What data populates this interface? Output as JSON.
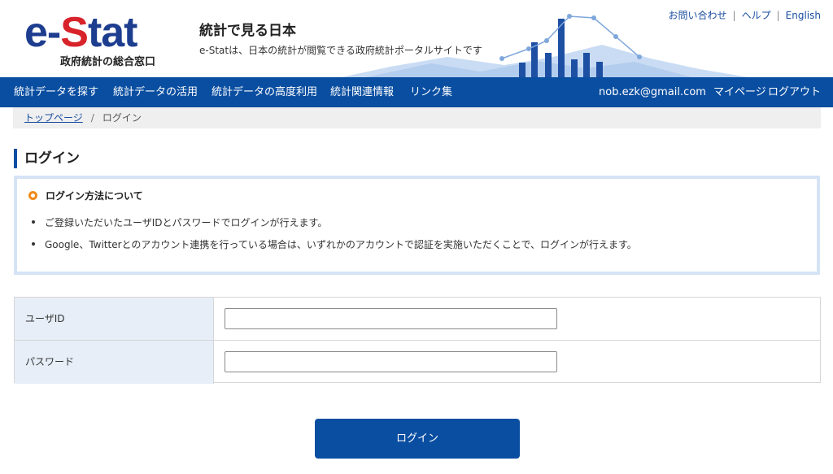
{
  "header": {
    "logo": {
      "e": "e",
      "dash": "-",
      "s": "S",
      "tat": "tat",
      "subtitle": "政府統計の総合窓口"
    },
    "site_title": "統計で見る日本",
    "site_desc": "e-Statは、日本の統計が閲覧できる政府統計ポータルサイトです",
    "utility_links": {
      "contact": "お問い合わせ",
      "help": "ヘルプ",
      "english": "English",
      "separator": "|"
    }
  },
  "nav": {
    "items": [
      "統計データを探す",
      "統計データの活用",
      "統計データの高度利用",
      "統計関連情報",
      "リンク集"
    ],
    "user_email": "nob.ezk@gmail.com",
    "mypage": "マイページ",
    "logout": "ログアウト"
  },
  "breadcrumb": {
    "home": "トップページ",
    "separator": "/",
    "current": "ログイン"
  },
  "page_title": "ログイン",
  "info": {
    "heading": "ログイン方法について",
    "items": [
      "ご登録いただいたユーザIDとパスワードでログインが行えます。",
      "Google、Twitterとのアカウント連携を行っている場合は、いずれかのアカウントで認証を実施いただくことで、ログインが行えます。"
    ]
  },
  "form": {
    "user_id_label": "ユーザID",
    "user_id_value": "",
    "password_label": "パスワード",
    "password_value": ""
  },
  "login_button": "ログイン",
  "colors": {
    "brand_blue": "#0a4ea1",
    "logo_red": "#d8232a",
    "accent_orange": "#f08a1c",
    "label_bg": "#e7eef8"
  }
}
